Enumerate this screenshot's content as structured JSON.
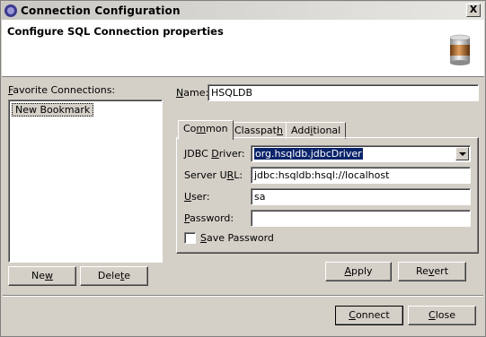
{
  "window": {
    "title": "Connection Configuration",
    "close_glyph": "X",
    "icon": "eclipse-icon"
  },
  "banner": {
    "title": "Configure SQL Connection properties",
    "icon": "database-icon"
  },
  "favorites": {
    "label_prefix": "F",
    "label_rest": "avorite Connections:",
    "items": [
      {
        "label": "New Bookmark",
        "selected": true
      }
    ],
    "new_button": {
      "pre": "Ne",
      "mn": "w",
      "post": ""
    },
    "delete_button": {
      "pre": "Dele",
      "mn": "t",
      "post": "e"
    }
  },
  "name": {
    "label_mn": "N",
    "label_rest": "ame:",
    "value": "HSQLDB"
  },
  "tabs": [
    {
      "pre": "Co",
      "mn": "m",
      "post": "mon",
      "active": true
    },
    {
      "pre": "Classpat",
      "mn": "h",
      "post": "",
      "active": false
    },
    {
      "pre": "Add",
      "mn": "i",
      "post": "tional",
      "active": false
    }
  ],
  "common": {
    "driver": {
      "pre": "JDBC ",
      "mn": "D",
      "post": "river:",
      "value": "org.hsqldb.jdbcDriver"
    },
    "url": {
      "pre": "Server U",
      "mn": "R",
      "post": "L:",
      "value": "jdbc:hsqldb:hsql://localhost"
    },
    "user": {
      "pre": "",
      "mn": "U",
      "post": "ser:",
      "value": "sa"
    },
    "password": {
      "pre": "",
      "mn": "P",
      "post": "assword:",
      "value": ""
    },
    "save_password": {
      "pre": "",
      "mn": "S",
      "post": "ave Password",
      "checked": false
    }
  },
  "apply_button": {
    "pre": "",
    "mn": "A",
    "post": "pply"
  },
  "revert_button": {
    "pre": "Re",
    "mn": "v",
    "post": "ert"
  },
  "connect_button": {
    "pre": "",
    "mn": "C",
    "post": "onnect"
  },
  "close_button": {
    "pre": "",
    "mn": "C",
    "post": "lose"
  }
}
